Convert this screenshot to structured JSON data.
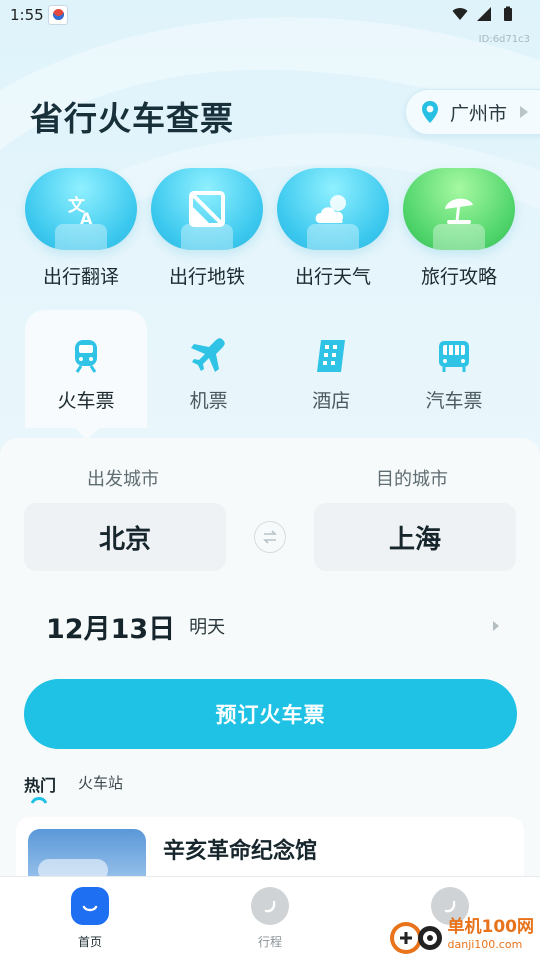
{
  "status_bar": {
    "time": "1:55",
    "id_label": "ID:6d71c3"
  },
  "header": {
    "title": "省行火车查票",
    "city": "广州市"
  },
  "services": [
    {
      "label": "出行翻译",
      "icon": "translate-icon"
    },
    {
      "label": "出行地铁",
      "icon": "metro-icon"
    },
    {
      "label": "出行天气",
      "icon": "weather-icon"
    },
    {
      "label": "旅行攻略",
      "icon": "travel-guide-icon"
    }
  ],
  "tabs": [
    {
      "label": "火车票",
      "icon": "train-icon",
      "active": true
    },
    {
      "label": "机票",
      "icon": "plane-icon",
      "active": false
    },
    {
      "label": "酒店",
      "icon": "hotel-icon",
      "active": false
    },
    {
      "label": "汽车票",
      "icon": "bus-icon",
      "active": false
    }
  ],
  "booking": {
    "from_label": "出发城市",
    "to_label": "目的城市",
    "from_city": "北京",
    "to_city": "上海",
    "date": "12月13日",
    "day_hint": "明天",
    "book_button": "预订火车票"
  },
  "sub_tabs": [
    {
      "label": "热门",
      "active": true
    },
    {
      "label": "火车站",
      "active": false
    }
  ],
  "attraction": {
    "title": "辛亥革命纪念馆"
  },
  "bottom_nav": [
    {
      "label": "首页",
      "active": true
    },
    {
      "label": "行程",
      "active": false
    },
    {
      "label": "",
      "active": false
    }
  ],
  "watermark": {
    "main": "单机100网",
    "sub": "danji100.com"
  },
  "colors": {
    "accent": "#1fc1e4",
    "nav_active": "#1f6ff2",
    "service_blue": "#3bc8ee",
    "service_green": "#4ed46a"
  }
}
